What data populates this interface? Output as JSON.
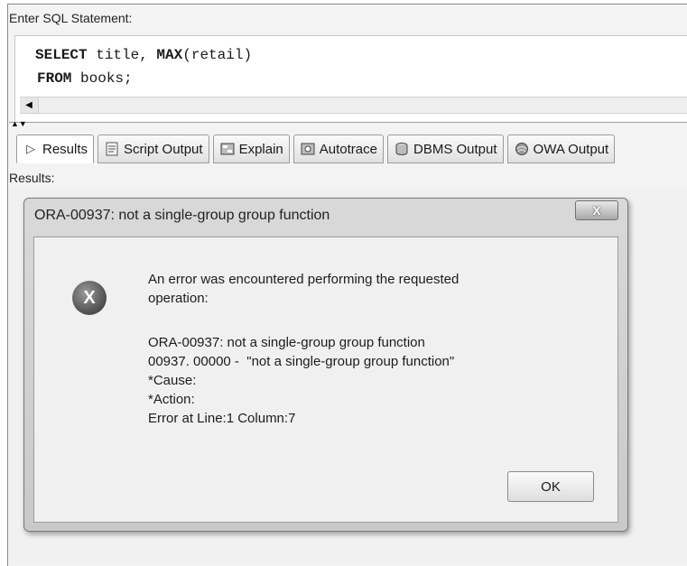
{
  "editor": {
    "label": "Enter SQL Statement:",
    "line1_kw1": "SELECT",
    "line1_mid": " title, ",
    "line1_kw2": "MAX",
    "line1_end": "(retail)",
    "line2_kw": "FROM",
    "line2_end": " books;"
  },
  "tabs": [
    {
      "label": "Results",
      "icon": "play-icon"
    },
    {
      "label": "Script Output",
      "icon": "script-icon"
    },
    {
      "label": "Explain",
      "icon": "explain-icon"
    },
    {
      "label": "Autotrace",
      "icon": "autotrace-icon"
    },
    {
      "label": "DBMS Output",
      "icon": "dbms-icon"
    },
    {
      "label": "OWA Output",
      "icon": "owa-icon"
    }
  ],
  "results_label": "Results:",
  "dialog": {
    "title": "ORA-00937: not a single-group group function",
    "close_label": "X",
    "icon_label": "X",
    "line1": "An error was encountered performing the requested",
    "line2": "operation:",
    "line3": "ORA-00937: not a single-group group function",
    "line4": "00937. 00000 -  \"not a single-group group function\"",
    "line5": "*Cause:",
    "line6": "*Action:",
    "line7": "Error at Line:1 Column:7",
    "ok_label": "OK"
  }
}
